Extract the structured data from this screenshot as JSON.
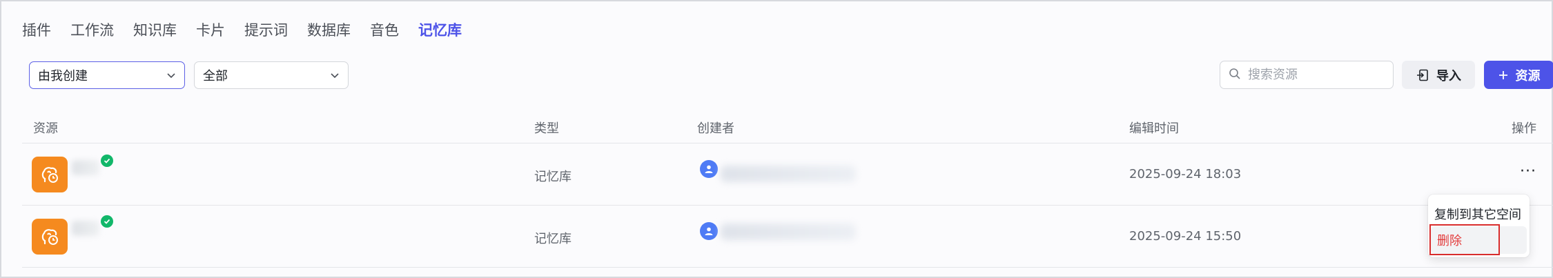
{
  "tabs": [
    {
      "label": "插件",
      "active": false
    },
    {
      "label": "工作流",
      "active": false
    },
    {
      "label": "知识库",
      "active": false
    },
    {
      "label": "卡片",
      "active": false
    },
    {
      "label": "提示词",
      "active": false
    },
    {
      "label": "数据库",
      "active": false
    },
    {
      "label": "音色",
      "active": false
    },
    {
      "label": "记忆库",
      "active": true
    }
  ],
  "filters": {
    "owner": {
      "value": "由我创建"
    },
    "type": {
      "value": "全部"
    }
  },
  "search": {
    "placeholder": "搜索资源",
    "value": ""
  },
  "actions": {
    "import_label": "导入",
    "add_label": "资源"
  },
  "table": {
    "headers": {
      "resource": "资源",
      "type": "类型",
      "creator": "创建者",
      "edited": "编辑时间",
      "ops": "操作"
    },
    "rows": [
      {
        "type": "记忆库",
        "edited": "2025-09-24 18:03",
        "more": "···"
      },
      {
        "type": "记忆库",
        "edited": "2025-09-24 15:50",
        "more": "···"
      }
    ]
  },
  "row_menu": {
    "copy_label": "复制到其它空间",
    "delete_label": "删除"
  },
  "colors": {
    "accent": "#4d53e8",
    "resource_icon": "#f58a1f",
    "status_ok": "#12b76a",
    "danger": "#e33b3b",
    "avatar": "#4e7bf5"
  }
}
